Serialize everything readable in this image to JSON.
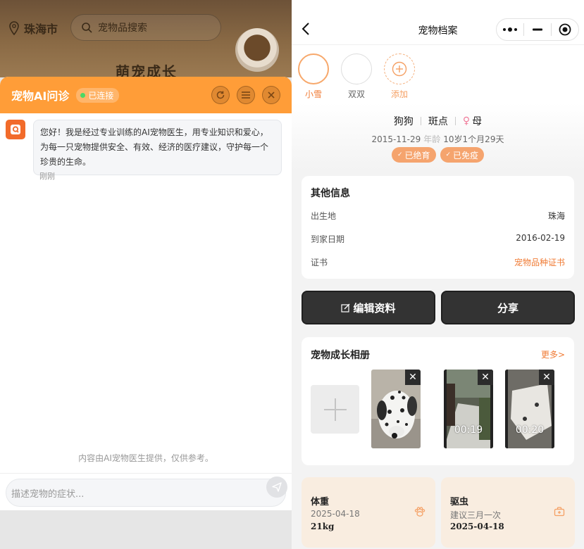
{
  "left": {
    "background": {
      "city": "珠海市",
      "search_placeholder": "宠物品搜索",
      "brand_text": "萌宠成长"
    },
    "chat": {
      "title": "宠物AI问诊",
      "status": "已连接",
      "header_icons": [
        "refresh-icon",
        "menu-list-icon",
        "close-icon"
      ],
      "message": "您好！我是经过专业训练的AI宠物医生，用专业知识和爱心，为每一只宠物提供安全、有效、经济的医疗建议，守护每一个珍贵的生命。",
      "message_time": "刚刚",
      "disclaimer": "内容由AI宠物医生提供，仅供参考。",
      "input_placeholder": "描述宠物的症状..."
    }
  },
  "right": {
    "nav": {
      "title": "宠物档案"
    },
    "pets": [
      {
        "name": "小雪",
        "active": true
      },
      {
        "name": "双双",
        "active": false
      },
      {
        "name": "添加",
        "is_add": true
      }
    ],
    "profile": {
      "species": "狗狗",
      "breed": "斑点",
      "gender_symbol": "♀",
      "gender": "母",
      "birthday": "2015-11-29",
      "age_label": "年龄",
      "age": "10岁1个月29天",
      "tags": [
        "已绝育",
        "已免疫"
      ]
    },
    "other_info": {
      "heading": "其他信息",
      "rows": [
        {
          "label": "出生地",
          "value": "珠海"
        },
        {
          "label": "到家日期",
          "value": "2016-02-19"
        },
        {
          "label": "证书",
          "value": "宠物品种证书"
        }
      ]
    },
    "actions": {
      "edit": "编辑资料",
      "share": "分享"
    },
    "album": {
      "heading": "宠物成长相册",
      "more": "更多>",
      "items": [
        {
          "type": "photo",
          "subject": "dalmatian"
        },
        {
          "type": "video",
          "duration": "00:19"
        },
        {
          "type": "video",
          "duration": "00:20"
        }
      ]
    },
    "weight": {
      "title": "体重",
      "date": "2025-04-18",
      "value": "21kg"
    },
    "deworm": {
      "title": "驱虫",
      "note": "建议三月一次",
      "date": "2025-04-18"
    }
  },
  "colors": {
    "accent_orange": "#ff9d38",
    "link_orange": "#f07b35",
    "tag_orange": "#f5a46e",
    "dark_button": "#333333",
    "mini_card_bg": "#f9ede0"
  }
}
